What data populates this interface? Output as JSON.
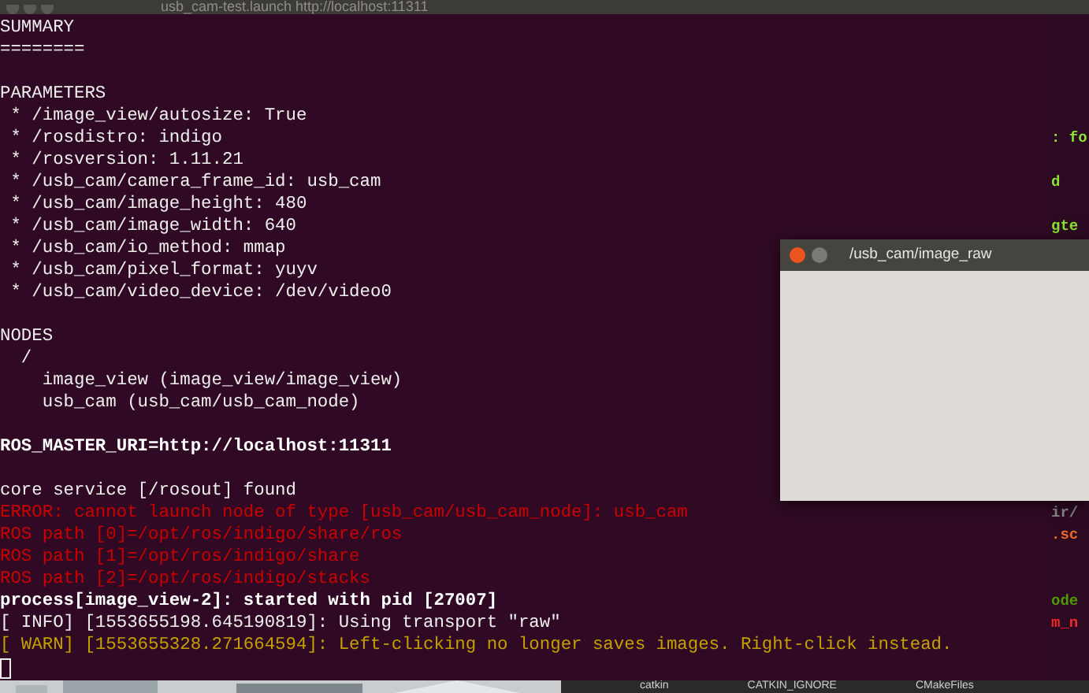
{
  "window": {
    "title": "usb_cam-test.launch http://localhost:11311"
  },
  "terminal": {
    "lines": [
      {
        "kind": "normal",
        "text": "SUMMARY"
      },
      {
        "kind": "normal",
        "text": "========"
      },
      {
        "kind": "blank"
      },
      {
        "kind": "normal",
        "text": "PARAMETERS"
      },
      {
        "kind": "normal",
        "text": " * /image_view/autosize: True"
      },
      {
        "kind": "normal",
        "text": " * /rosdistro: indigo"
      },
      {
        "kind": "normal",
        "text": " * /rosversion: 1.11.21"
      },
      {
        "kind": "normal",
        "text": " * /usb_cam/camera_frame_id: usb_cam"
      },
      {
        "kind": "normal",
        "text": " * /usb_cam/image_height: 480"
      },
      {
        "kind": "normal",
        "text": " * /usb_cam/image_width: 640"
      },
      {
        "kind": "normal",
        "text": " * /usb_cam/io_method: mmap"
      },
      {
        "kind": "normal",
        "text": " * /usb_cam/pixel_format: yuyv"
      },
      {
        "kind": "normal",
        "text": " * /usb_cam/video_device: /dev/video0"
      },
      {
        "kind": "blank"
      },
      {
        "kind": "normal",
        "text": "NODES"
      },
      {
        "kind": "normal",
        "text": "  /"
      },
      {
        "kind": "normal",
        "text": "    image_view (image_view/image_view)"
      },
      {
        "kind": "normal",
        "text": "    usb_cam (usb_cam/usb_cam_node)"
      },
      {
        "kind": "blank"
      },
      {
        "kind": "bold",
        "text": "ROS_MASTER_URI=http://localhost:11311"
      },
      {
        "kind": "blank"
      },
      {
        "kind": "normal",
        "text": "core service [/rosout] found"
      },
      {
        "kind": "error",
        "text": "ERROR: cannot launch node of type [usb_cam/usb_cam_node]: usb_cam"
      },
      {
        "kind": "error",
        "text": "ROS path [0]=/opt/ros/indigo/share/ros"
      },
      {
        "kind": "error",
        "text": "ROS path [1]=/opt/ros/indigo/share"
      },
      {
        "kind": "error",
        "text": "ROS path [2]=/opt/ros/indigo/stacks"
      },
      {
        "kind": "bold",
        "text": "process[image_view-2]: started with pid [27007]"
      },
      {
        "kind": "normal",
        "text": "[ INFO] [1553655198.645190819]: Using transport \"raw\""
      },
      {
        "kind": "warn",
        "text": "[ WARN] [1553655328.271664594]: Left-clicking no longer saves images. Right-click instead."
      },
      {
        "kind": "cursor"
      }
    ]
  },
  "background_terminal": {
    "lines": [
      {
        "kind": "blank"
      },
      {
        "kind": "blank"
      },
      {
        "kind": "blank"
      },
      {
        "kind": "blank"
      },
      {
        "kind": "blank"
      },
      {
        "kind": "text",
        "text": ": fo",
        "color": "#8ae234"
      },
      {
        "kind": "blank"
      },
      {
        "kind": "text",
        "text": "d",
        "color": "#8ae234"
      },
      {
        "kind": "blank"
      },
      {
        "kind": "text",
        "text": "gte",
        "color": "#8ae234"
      },
      {
        "kind": "blank"
      },
      {
        "kind": "blank"
      },
      {
        "kind": "blank"
      },
      {
        "kind": "blank"
      },
      {
        "kind": "blank"
      },
      {
        "kind": "blank"
      },
      {
        "kind": "blank"
      },
      {
        "kind": "blank"
      },
      {
        "kind": "blank"
      },
      {
        "kind": "blank"
      },
      {
        "kind": "blank"
      },
      {
        "kind": "blank"
      },
      {
        "kind": "text",
        "text": "ir/",
        "color": "#8a8a8a"
      },
      {
        "kind": "text",
        "text": ".sc",
        "color": "#ef6a29"
      },
      {
        "kind": "blank"
      },
      {
        "kind": "blank"
      },
      {
        "kind": "text",
        "text": "ode",
        "color": "#4e9a06"
      },
      {
        "kind": "text",
        "text": "m_n",
        "color": "#ef2929"
      }
    ]
  },
  "file_list": [
    "catkin",
    "CATKIN_IGNORE",
    "CMakeFiles"
  ],
  "image_window": {
    "title": "/usb_cam/image_raw"
  }
}
